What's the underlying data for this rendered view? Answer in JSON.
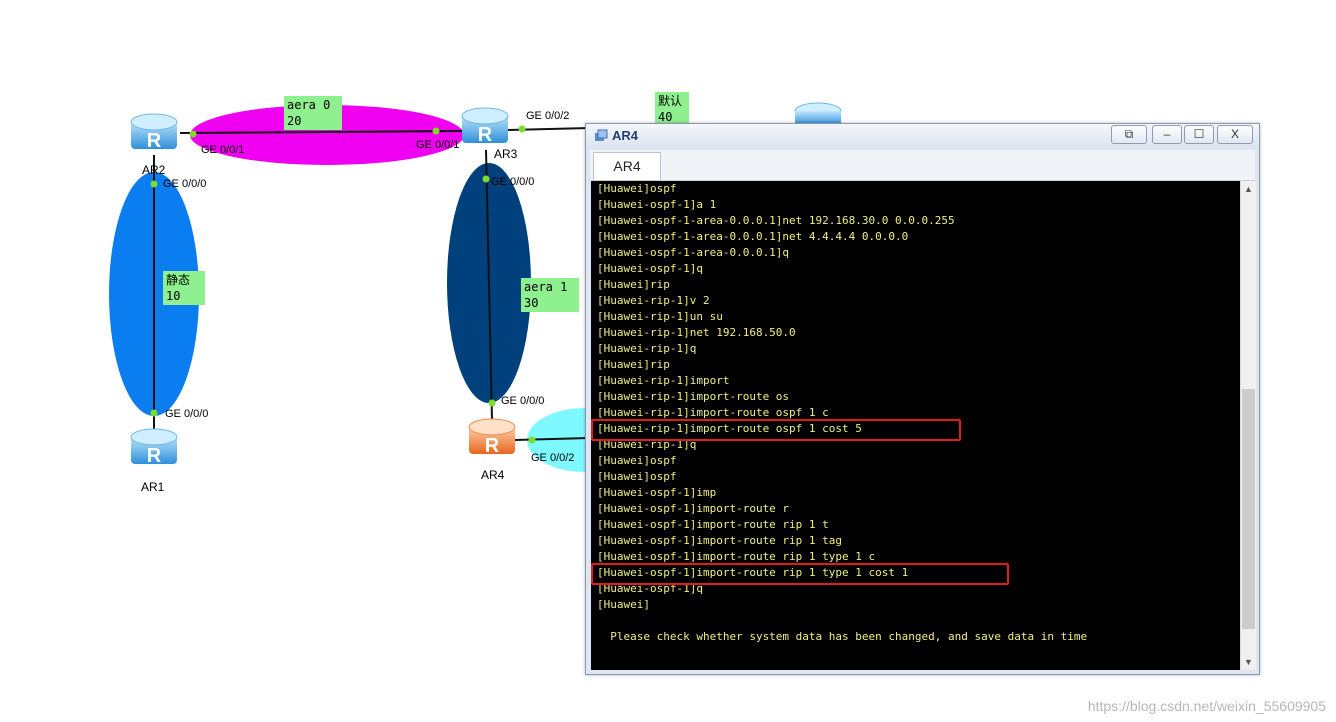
{
  "topology": {
    "routers": [
      {
        "name": "AR2",
        "color": "#3fa9f5"
      },
      {
        "name": "AR3",
        "color": "#3fa9f5"
      },
      {
        "name": "AR1",
        "color": "#3fa9f5"
      },
      {
        "name": "AR4",
        "color": "#f4823a"
      }
    ],
    "areas": [
      {
        "label": "aera 0\n20",
        "color": "#f000f0"
      },
      {
        "label": "静态\n10",
        "color": "#0a7df0"
      },
      {
        "label": "aera 1\n30",
        "color": "#00417d"
      },
      {
        "label": "默认\n40",
        "color": "#7ef9ff"
      }
    ],
    "ports": {
      "ar2_ge001": "GE 0/0/1",
      "ar2_ge000": "GE 0/0/0",
      "ar3_ge001": "GE 0/0/1",
      "ar3_ge002": "GE 0/0/2",
      "ar3_ge000": "GE 0/0/0",
      "ar1_ge000": "GE 0/0/0",
      "ar4_ge000": "GE 0/0/0",
      "ar4_ge002": "GE 0/0/2"
    }
  },
  "window": {
    "title": "AR4",
    "tab_label": "AR4",
    "buttons": {
      "restore": "⧉",
      "minimize": "–",
      "maximize": "☐",
      "close": "X"
    }
  },
  "console": {
    "lines": [
      "[Huawei]ospf",
      "[Huawei-ospf-1]a 1",
      "[Huawei-ospf-1-area-0.0.0.1]net 192.168.30.0 0.0.0.255",
      "[Huawei-ospf-1-area-0.0.0.1]net 4.4.4.4 0.0.0.0",
      "[Huawei-ospf-1-area-0.0.0.1]q",
      "[Huawei-ospf-1]q",
      "[Huawei]rip",
      "[Huawei-rip-1]v 2",
      "[Huawei-rip-1]un su",
      "[Huawei-rip-1]net 192.168.50.0",
      "[Huawei-rip-1]q",
      "[Huawei]rip",
      "[Huawei-rip-1]import",
      "[Huawei-rip-1]import-route os",
      "[Huawei-rip-1]import-route ospf 1 c",
      "[Huawei-rip-1]import-route ospf 1 cost 5",
      "[Huawei-rip-1]q",
      "[Huawei]ospf",
      "[Huawei]ospf",
      "[Huawei-ospf-1]imp",
      "[Huawei-ospf-1]import-route r",
      "[Huawei-ospf-1]import-route rip 1 t",
      "[Huawei-ospf-1]import-route rip 1 tag",
      "[Huawei-ospf-1]import-route rip 1 type 1 c",
      "[Huawei-ospf-1]import-route rip 1 type 1 cost 1",
      "[Huawei-ospf-1]q",
      "[Huawei]",
      "",
      "  Please check whether system data has been changed, and save data in time"
    ]
  },
  "watermark": "https://blog.csdn.net/weixin_55609905"
}
